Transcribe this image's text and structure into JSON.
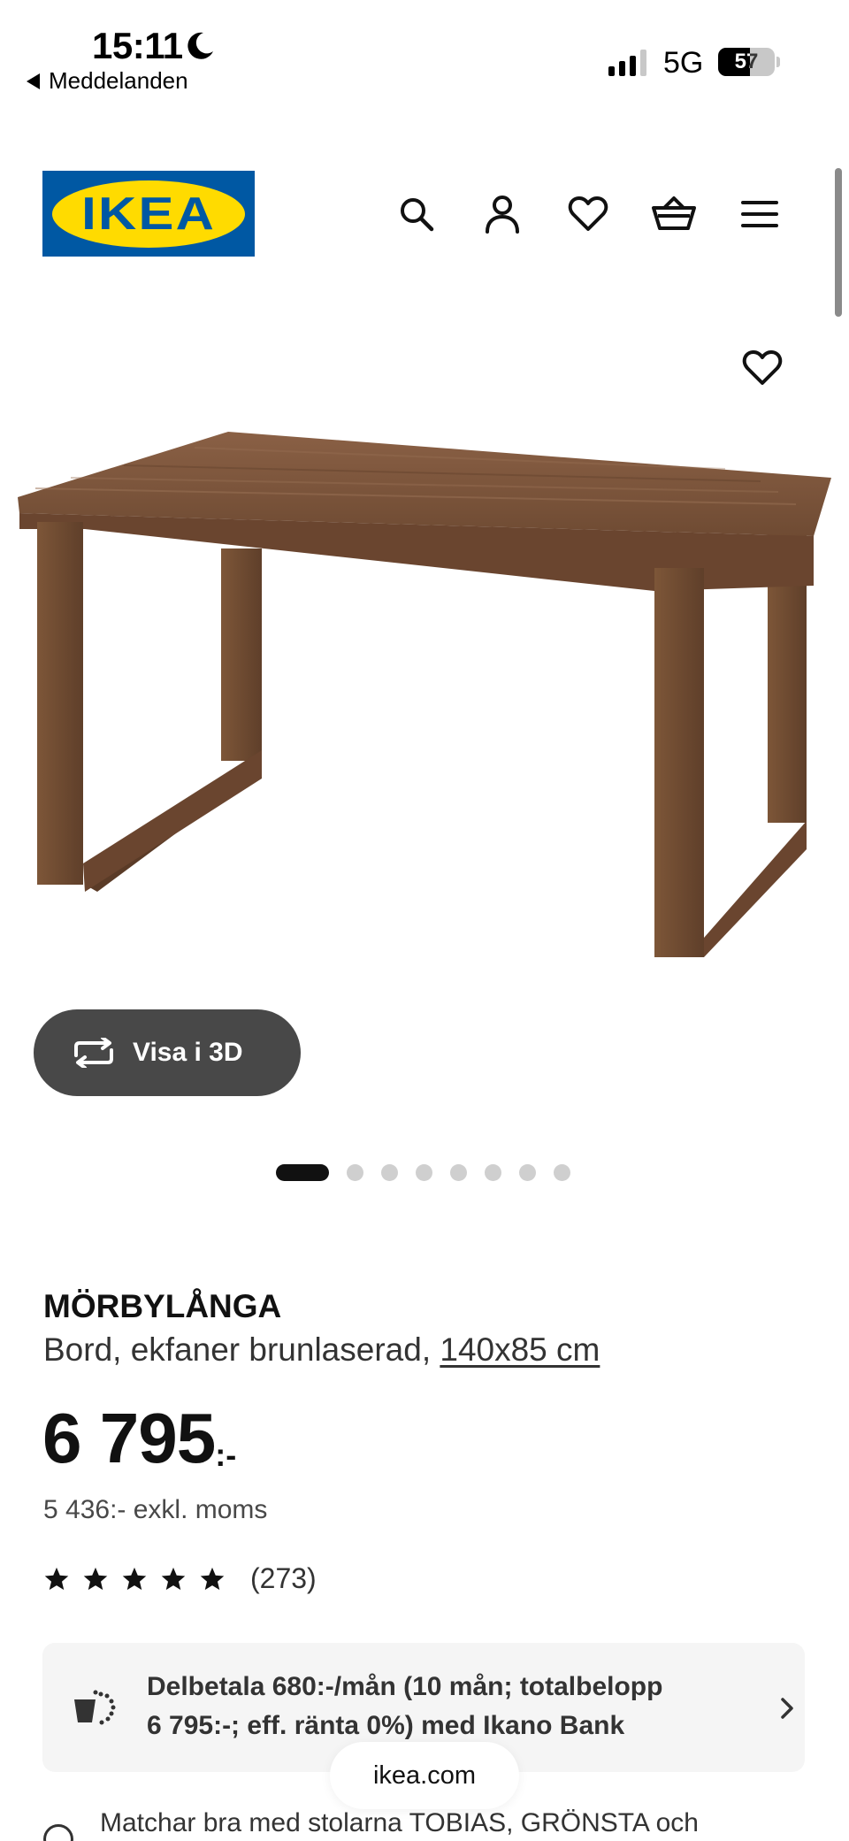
{
  "status_bar": {
    "time": "15:11",
    "back_app": "Meddelanden",
    "network": "5G",
    "battery": "57"
  },
  "header": {
    "logo_text": "IKEA",
    "icons": [
      "search-icon",
      "user-icon",
      "heart-icon",
      "cart-icon",
      "menu-icon"
    ]
  },
  "gallery": {
    "view3d_label": "Visa i 3D",
    "dot_count": 8,
    "active_dot": 0
  },
  "product": {
    "name": "MÖRBYLÅNGA",
    "description": "Bord, ekfaner brunlaserad,",
    "size": "140x85 cm",
    "price_integer": "6 795",
    "price_suffix": ":-",
    "price_ex_vat": "5 436:- exkl. moms",
    "rating_stars": 5,
    "review_count": "(273)"
  },
  "installment": {
    "line1": "Delbetala 680:-/mån (10 mån; totalbelopp",
    "line2": "6 795:-; eff. ränta 0%) med Ikano Bank"
  },
  "browser": {
    "url": "ikea.com"
  },
  "matching": {
    "text": "Matchar bra med stolarna TOBIAS, GRÖNSTA och"
  },
  "colors": {
    "ikea_blue": "#0058a3",
    "ikea_yellow": "#ffdb00",
    "pill_dark": "#484848",
    "wood": "#7a5338"
  }
}
